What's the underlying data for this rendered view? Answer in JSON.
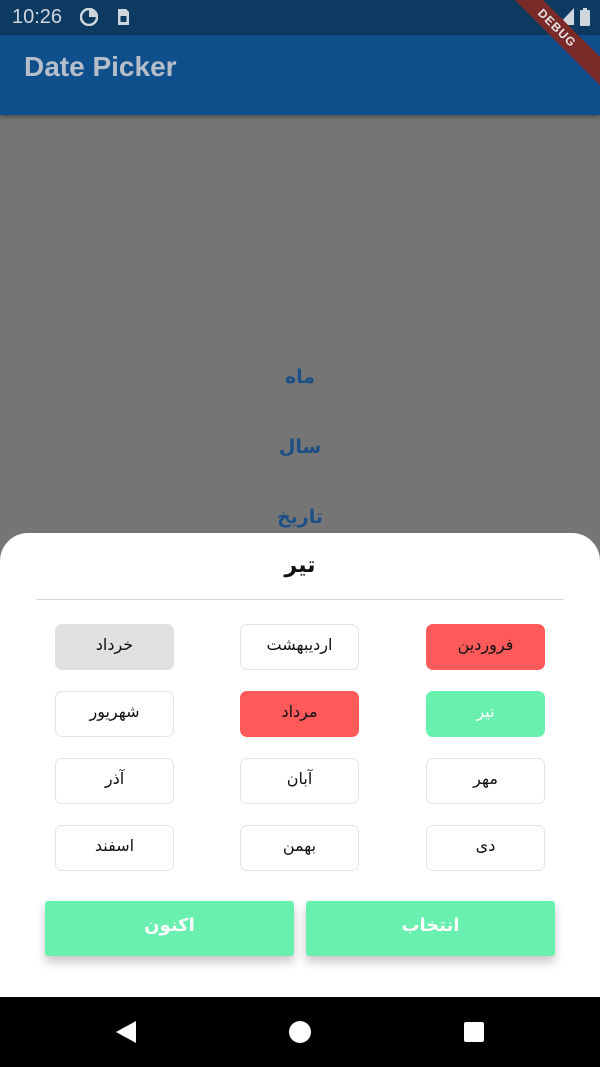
{
  "status": {
    "time": "10:26",
    "debug": "DEBUG"
  },
  "app": {
    "title": "Date Picker"
  },
  "links": {
    "month": "ماه",
    "year": "سال",
    "date": "تاریخ"
  },
  "sheet": {
    "title": "تیر",
    "months": [
      {
        "label": "خرداد",
        "state": "disabled"
      },
      {
        "label": "اردیبهشت",
        "state": "normal"
      },
      {
        "label": "فروردین",
        "state": "highlighted-red"
      },
      {
        "label": "شهریور",
        "state": "normal"
      },
      {
        "label": "مرداد",
        "state": "highlighted-red"
      },
      {
        "label": "تیر",
        "state": "selected"
      },
      {
        "label": "آذر",
        "state": "normal"
      },
      {
        "label": "آبان",
        "state": "normal"
      },
      {
        "label": "مهر",
        "state": "normal"
      },
      {
        "label": "اسفند",
        "state": "normal"
      },
      {
        "label": "بهمن",
        "state": "normal"
      },
      {
        "label": "دی",
        "state": "normal"
      }
    ],
    "now_label": "اکنون",
    "select_label": "انتخاب"
  },
  "colors": {
    "accent_green": "#69f0ae",
    "highlight_red": "#ff5a5a",
    "app_bar": "#0f4f8c"
  },
  "icons": [
    "data-saver-icon",
    "sim-card-icon",
    "wifi-icon",
    "signal-icon",
    "battery-icon",
    "back-nav-icon",
    "home-nav-icon",
    "recents-nav-icon"
  ]
}
